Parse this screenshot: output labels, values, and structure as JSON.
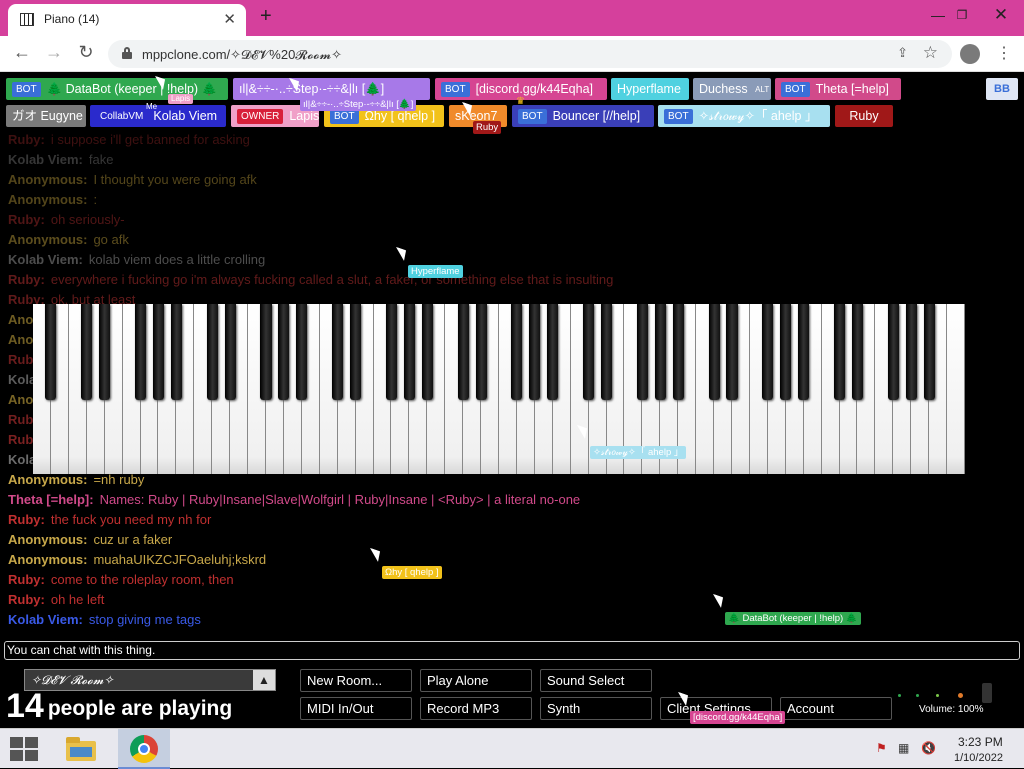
{
  "browser": {
    "tab_title": "Piano (14)",
    "tab_close": "✕",
    "new_tab": "+",
    "win_min": "—",
    "win_max": "❐",
    "win_close": "✕",
    "back": "←",
    "forward": "→",
    "reload": "↻",
    "url": "mppclone.com/✧𝓓𝓔𝓥%20𝓡𝓸𝓸𝓶✧",
    "share": "⇪",
    "star": "☆",
    "menu": "⋮"
  },
  "participants": [
    {
      "badge": "BOT",
      "badge_bg": "#3a6fd8",
      "name": "🌲 DataBot (keeper | !help) 🌲",
      "bg": "#2fa84f",
      "color": "#ffffff"
    },
    {
      "badge": "",
      "badge_bg": "",
      "name": "ıl|&÷÷-·..÷Step·-÷÷&|lı [🌲]",
      "bg": "#a779e8",
      "color": "#ffffff"
    },
    {
      "badge": "BOT",
      "badge_bg": "#3a6fd8",
      "name": "[discord.gg/k44Eqha]",
      "bg": "#d64592",
      "color": "#ffffff"
    },
    {
      "badge": "",
      "badge_bg": "",
      "name": "Hyperflame",
      "bg": "#4fd1e0",
      "color": "#ffffff"
    },
    {
      "badge": "ALT",
      "badge_bg": "#8a9bb8",
      "name": "Duchess",
      "bg": "#8a9bb8",
      "color": "#ffffff"
    },
    {
      "badge": "BOT",
      "badge_bg": "#3a6fd8",
      "name": "Theta [=help]",
      "bg": "#d14a8a",
      "color": "#ffffff"
    },
    {
      "badge": "",
      "badge_bg": "",
      "name": "BB",
      "bg": "#dfe6f5",
      "color": "#3a6fd8"
    },
    {
      "badge": "",
      "badge_bg": "",
      "name": "ガオ Eugyne",
      "bg": "#7a7a7a",
      "color": "#ffffff"
    },
    {
      "badge": "CollabVM",
      "badge_bg": "#2a2acc",
      "name": "Kolab Viem",
      "bg": "#2a2acc",
      "color": "#ffffff"
    },
    {
      "badge": "OWNER",
      "badge_bg": "#d8203a",
      "name": "Lapis",
      "bg": "#f0a0c8",
      "color": "#ffffff"
    },
    {
      "badge": "BOT",
      "badge_bg": "#3a6fd8",
      "name": "Ωhy [ qhelp ]",
      "bg": "#f2c21a",
      "color": "#ffffff"
    },
    {
      "badge": "",
      "badge_bg": "",
      "name": "sKeon7",
      "bg": "#f08a2a",
      "color": "#ffffff"
    },
    {
      "badge": "BOT",
      "badge_bg": "#3a6fd8",
      "name": "Bouncer [//help]",
      "bg": "#3a3fb8",
      "color": "#ffffff"
    },
    {
      "badge": "BOT",
      "badge_bg": "#3a6fd8",
      "name": "✧𝓈𝓉𝓇𝑜𝓌𝓎✧「 ahelp 」",
      "bg": "#a8e0f0",
      "color": "#ffffff"
    },
    {
      "badge": "",
      "badge_bg": "",
      "name": "Ruby",
      "bg": "#a01818",
      "color": "#ffffff"
    }
  ],
  "overlay_labels": {
    "lapis": "Lapis",
    "me": "Me",
    "step": "ıl|&÷÷-·..÷Step·-÷÷&|lı [🌲]",
    "ruby": "Ruby",
    "crown": "♛"
  },
  "chat": [
    {
      "name": "Ruby:",
      "text": "i suppose i'll get banned for asking",
      "color": "#b03030",
      "dim": 0.35
    },
    {
      "name": "Kolab Viem:",
      "text": "fake",
      "color": "#9a9a9a",
      "dim": 0.35
    },
    {
      "name": "Anonymous:",
      "text": "I thought you were going afk",
      "color": "#b89a3a",
      "dim": 0.45
    },
    {
      "name": "Anonymous:",
      "text": ":",
      "color": "#b89a3a",
      "dim": 0.45
    },
    {
      "name": "Ruby:",
      "text": "oh seriously-",
      "color": "#b03030",
      "dim": 0.45
    },
    {
      "name": "Anonymous:",
      "text": "go afk",
      "color": "#b89a3a",
      "dim": 0.5
    },
    {
      "name": "Kolab Viem:",
      "text": "kolab viem does a little crolling",
      "color": "#9a9a9a",
      "dim": 0.5
    },
    {
      "name": "Ruby:",
      "text": "everywhere i fucking go i'm always fucking called a slut, a faker, or something else that is insulting",
      "color": "#b03030",
      "dim": 0.55
    },
    {
      "name": "Ruby:",
      "text": "ok, but at least",
      "color": "#b03030",
      "dim": 0.55
    },
    {
      "name": "Anonymous:",
      "text": "",
      "color": "#b89a3a",
      "dim": 0.6
    },
    {
      "name": "Anonymous:",
      "text": "",
      "color": "#b89a3a",
      "dim": 0.6
    },
    {
      "name": "Ruby:",
      "text": "",
      "color": "#b03030",
      "dim": 0.6
    },
    {
      "name": "Kolab Viem:",
      "text": "",
      "color": "#9a9a9a",
      "dim": 0.6
    },
    {
      "name": "Anonymous:",
      "text": "",
      "color": "#b89a3a",
      "dim": 0.65
    },
    {
      "name": "Ruby:",
      "text": "",
      "color": "#b03030",
      "dim": 0.65
    },
    {
      "name": "Ruby:",
      "text": "",
      "color": "#b03030",
      "dim": 0.7
    },
    {
      "name": "Kolab Viem:",
      "text": "",
      "color": "#9a9a9a",
      "dim": 0.7
    },
    {
      "name": "Anonymous:",
      "text": "=nh ruby",
      "color": "#c8a84a",
      "dim": 1
    },
    {
      "name": "Theta [=help]:",
      "text": "Names: Ruby | Ruby|Insane|Slave|Wolfgirl | Ruby|Insane | <Ruby> | a literal no-one",
      "color": "#d14a8a",
      "dim": 1
    },
    {
      "name": "Ruby:",
      "text": "the fuck you need my nh for",
      "color": "#c03030",
      "dim": 1
    },
    {
      "name": "Anonymous:",
      "text": "cuz ur a faker",
      "color": "#c8a84a",
      "dim": 1
    },
    {
      "name": "Anonymous:",
      "text": "muahaUIKZCJFOaeluhj;kskrd",
      "color": "#c8a84a",
      "dim": 1
    },
    {
      "name": "Ruby:",
      "text": "come to the roleplay room, then",
      "color": "#c03030",
      "dim": 1
    },
    {
      "name": "Ruby:",
      "text": "oh he left",
      "color": "#c03030",
      "dim": 1
    },
    {
      "name": "Kolab Viem:",
      "text": "stop giving me tags",
      "color": "#3a5ae8",
      "dim": 1
    }
  ],
  "cursor_tags": [
    {
      "text": "Hyperflame",
      "bg": "#4fd1e0"
    },
    {
      "text": "✧𝓈𝓉𝓇𝑜𝓌𝓎✧「 ahelp 」",
      "bg": "#a8e0f0"
    },
    {
      "text": "Ωhy [ qhelp ]",
      "bg": "#f2c21a"
    },
    {
      "text": "🌲 DataBot (keeper | !help) 🌲",
      "bg": "#2fa84f"
    },
    {
      "text": "[discord.gg/k44Eqha]",
      "bg": "#d64592"
    }
  ],
  "chat_input_placeholder": "You can chat with this thing.",
  "room": {
    "name": "✧𝓓𝓔𝓥 𝓡𝓸𝓸𝓶✧",
    "arrow": "▲"
  },
  "players": {
    "count": "14",
    "text": "people are playing"
  },
  "controls": {
    "new_room": "New Room...",
    "play_alone": "Play Alone",
    "sound_select": "Sound Select",
    "midi": "MIDI In/Out",
    "record": "Record MP3",
    "synth": "Synth",
    "client_settings": "Client Settings",
    "account": "Account"
  },
  "volume": {
    "label": "Volume: 100%",
    "level": 1.0
  },
  "taskbar": {
    "tray_flag": "⚑",
    "tray_net": "▦",
    "tray_vol": "🔇",
    "time": "3:23 PM",
    "date": "1/10/2022"
  }
}
